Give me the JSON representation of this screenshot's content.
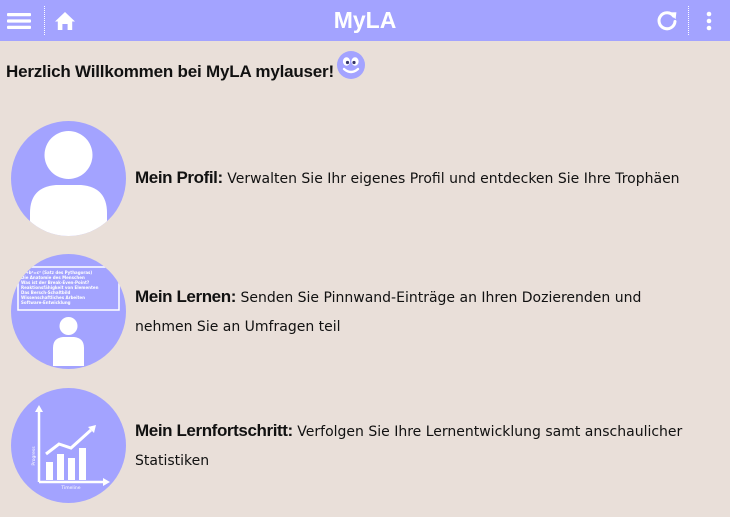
{
  "header": {
    "title": "MyLA",
    "menu_icon": "hamburger-menu-icon",
    "home_icon": "home-icon",
    "reload_icon": "reload-icon",
    "more_icon": "more-vertical-icon"
  },
  "welcome": {
    "text": "Herzlich Willkommen bei MyLA mylauser!",
    "emoji_icon": "smiley-icon"
  },
  "items": [
    {
      "title": "Mein Profil:",
      "description": "Verwalten Sie Ihr eigenes Profil und entdecken Sie Ihre Trophäen",
      "icon": "profile-avatar-icon"
    },
    {
      "title": "Mein Lernen:",
      "description": "Senden Sie Pinnwand-Einträge an Ihren Dozierenden und nehmen Sie an Umfragen teil",
      "icon": "learning-board-icon",
      "board_lines": [
        "a²+b²=c² (Satz des Pythagoras)",
        "Die Anatomie des Menschen",
        "Was ist der Break-Even-Point?",
        "Reaktionsfähigkeit von Elementen",
        "Das Bersch-Schaltbild",
        "Wissenschaftliches Arbeiten",
        "Software-Entwicklung"
      ]
    },
    {
      "title": "Mein Lernfortschritt:",
      "description": "Verfolgen Sie Ihre Lernentwicklung samt anschaulicher Statistiken",
      "icon": "progress-chart-icon",
      "chart_y_label": "Progress",
      "chart_x_label": "Timeline"
    }
  ],
  "colors": {
    "accent": "#a3a3ff",
    "background": "#e9dfd9"
  }
}
